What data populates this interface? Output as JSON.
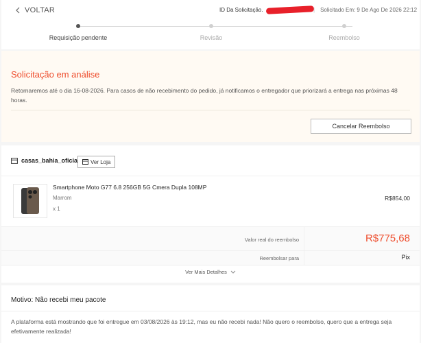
{
  "header": {
    "back_label": "VOLTAR",
    "request_id_label": "ID Da Solicitação.",
    "request_id_value_redacted": true,
    "requested_at": "Solicitado Em:  9 De Ago De 2026 22:12"
  },
  "progress": {
    "current_step": 0,
    "steps": [
      {
        "label": "Requisição pendente"
      },
      {
        "label": "Revisão"
      },
      {
        "label": "Reembolso"
      }
    ]
  },
  "status": {
    "title": "Solicitação em análise",
    "message": "Retornaremos até o dia 16-08-2026. Para casos de não recebimento do pedido, já notificamos o entregador que priorizará a entrega nas próximas 48 horas.",
    "cancel_label": "Cancelar Reembolso"
  },
  "order": {
    "shop_name": "casas_bahia_oficial",
    "store_button_label": "Ver Loja",
    "product": {
      "name": "Smartphone Moto G77 6.8 256GB 5G Cmera Dupla 108MP",
      "variant": "Marrom",
      "quantity": "x 1",
      "price": "R$854,00"
    },
    "refund_amount_label": "Valor real do reembolso",
    "refund_amount": "R$775,68",
    "refund_to_label": "Reembolsar para",
    "refund_to": "Pix",
    "more_details_label": "Ver Mais Detalhes"
  },
  "reason": {
    "title": "Motivo: Não recebi meu pacote",
    "description": "A plataforma está mostrando que foi entregue em 03/08/2026 às 19:12, mas eu não recebi nada! Não quero o reembolso, quero que a entrega seja efetivamente realizada!"
  },
  "colors": {
    "accent": "#ee4d2d",
    "status_background": "#fffaf3",
    "active_step": "#555555",
    "inactive_step": "#d0d0d0"
  }
}
